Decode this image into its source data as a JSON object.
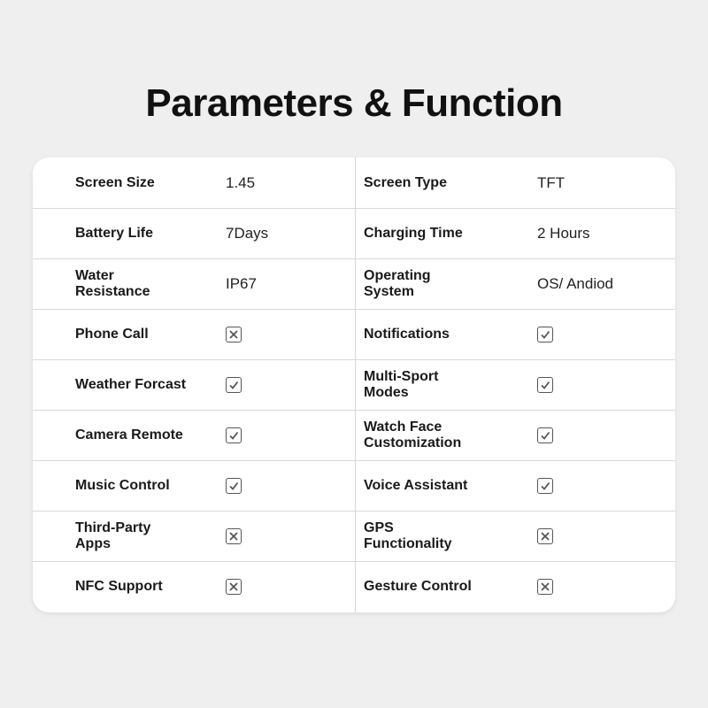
{
  "title": "Parameters & Function",
  "rows": [
    {
      "left": {
        "label": "Screen Size",
        "value": "1.45",
        "type": "text"
      },
      "right": {
        "label": "Screen Type",
        "value": "TFT",
        "type": "text"
      }
    },
    {
      "left": {
        "label": "Battery Life",
        "value": "7Days",
        "type": "text"
      },
      "right": {
        "label": "Charging Time",
        "value": "2 Hours",
        "type": "text"
      }
    },
    {
      "left": {
        "label": "Water Resistance",
        "value": "IP67",
        "type": "text"
      },
      "right": {
        "label": "Operating System",
        "value": "OS/ Andiod",
        "type": "text"
      }
    },
    {
      "left": {
        "label": "Phone Call",
        "value": "cross",
        "type": "icon"
      },
      "right": {
        "label": "Notifications",
        "value": "check",
        "type": "icon"
      }
    },
    {
      "left": {
        "label": "Weather Forcast",
        "value": "check",
        "type": "icon"
      },
      "right": {
        "label": "Multi-Sport Modes",
        "value": "check",
        "type": "icon"
      }
    },
    {
      "left": {
        "label": "Camera Remote",
        "value": "check",
        "type": "icon"
      },
      "right": {
        "label": "Watch Face Customization",
        "value": "check",
        "type": "icon"
      }
    },
    {
      "left": {
        "label": "Music Control",
        "value": "check",
        "type": "icon"
      },
      "right": {
        "label": "Voice Assistant",
        "value": "check",
        "type": "icon"
      }
    },
    {
      "left": {
        "label": "Third-Party Apps",
        "value": "cross",
        "type": "icon"
      },
      "right": {
        "label": "GPS Functionality",
        "value": "cross",
        "type": "icon"
      }
    },
    {
      "left": {
        "label": "NFC Support",
        "value": "cross",
        "type": "icon"
      },
      "right": {
        "label": "Gesture Control",
        "value": "cross",
        "type": "icon"
      }
    }
  ]
}
